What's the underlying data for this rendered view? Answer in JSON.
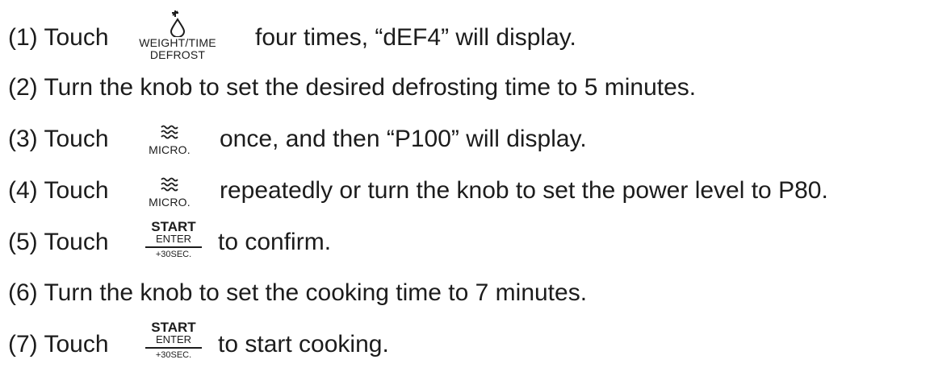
{
  "steps": [
    {
      "prefix": "(1) Touch",
      "icon": {
        "name": "weight-time-defrost",
        "glyph": "drop-icon",
        "label_line1": "WEIGHT/TIME",
        "label_line2": "DEFROST"
      },
      "suffix": "four times, “dEF4” will display."
    },
    {
      "text": "(2) Turn the knob to set the desired defrosting time to 5 minutes."
    },
    {
      "prefix": "(3) Touch",
      "icon": {
        "name": "micro",
        "glyph": "microwave-waves-icon",
        "label": "MICRO."
      },
      "suffix": "once, and then “P100” will display."
    },
    {
      "prefix": "(4) Touch",
      "icon": {
        "name": "micro",
        "glyph": "microwave-waves-icon",
        "label": "MICRO."
      },
      "suffix": "repeatedly or turn the knob to set the power level to P80."
    },
    {
      "prefix": "(5) Touch",
      "icon": {
        "name": "start-enter",
        "top": "START",
        "middle": "ENTER",
        "bottom": "+30SEC."
      },
      "suffix": "to confirm."
    },
    {
      "text": "(6) Turn the knob to set the cooking time to 7 minutes."
    },
    {
      "prefix": "(7) Touch",
      "icon": {
        "name": "start-enter",
        "top": "START",
        "middle": "ENTER",
        "bottom": "+30SEC."
      },
      "suffix": "to start cooking."
    }
  ]
}
